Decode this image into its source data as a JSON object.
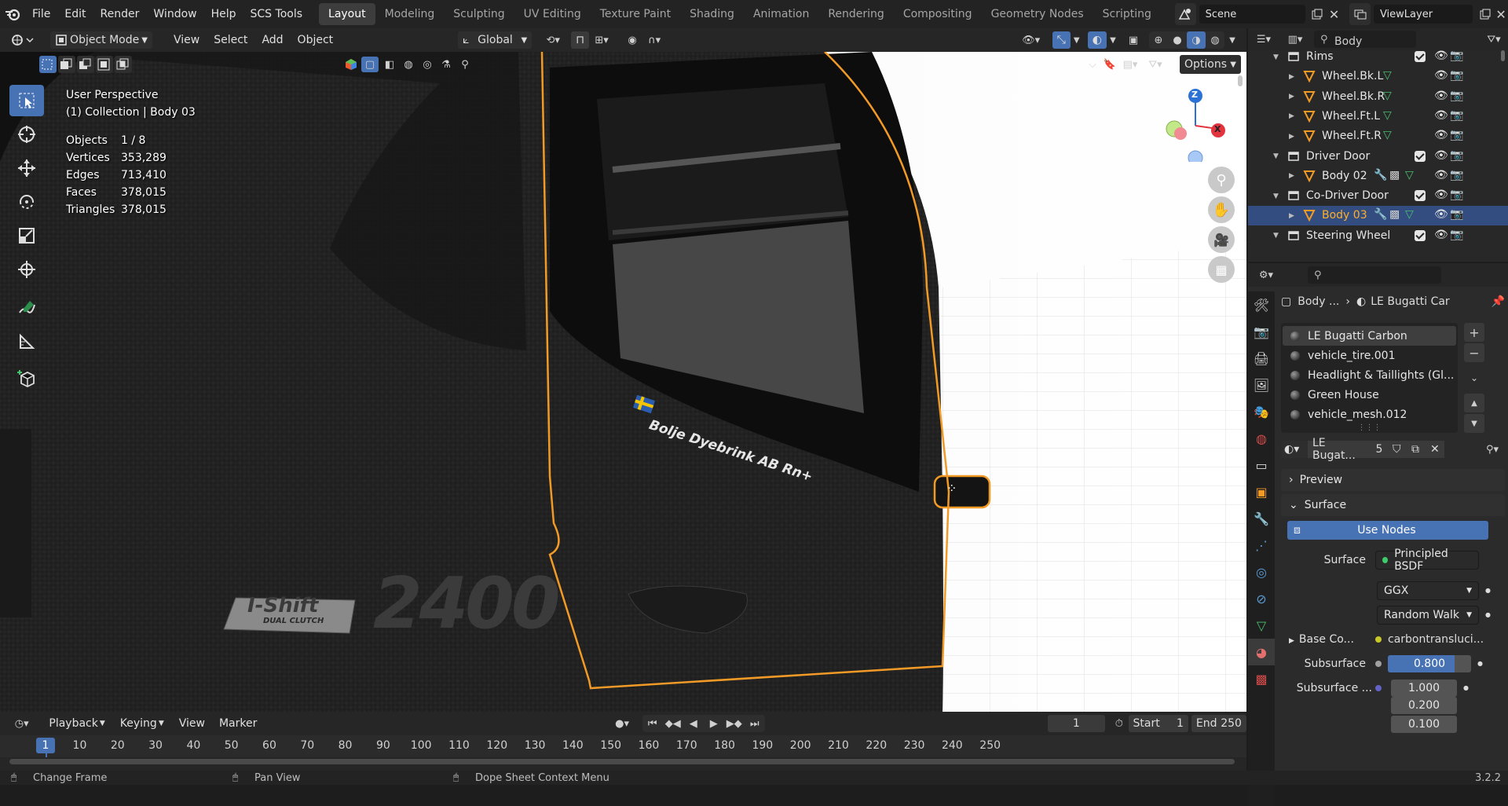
{
  "topbar": {
    "menus": [
      "File",
      "Edit",
      "Render",
      "Window",
      "Help",
      "SCS Tools"
    ],
    "workspaces": [
      "Layout",
      "Modeling",
      "Sculpting",
      "UV Editing",
      "Texture Paint",
      "Shading",
      "Animation",
      "Rendering",
      "Compositing",
      "Geometry Nodes",
      "Scripting"
    ],
    "active_workspace": "Layout",
    "scene": "Scene",
    "view_layer": "ViewLayer"
  },
  "viewport_header": {
    "mode": "Object Mode",
    "menus": [
      "View",
      "Select",
      "Add",
      "Object"
    ],
    "orientation": "Global",
    "options": "Options"
  },
  "overlay_text": {
    "perspective": "User Perspective",
    "collection": "(1) Collection | Body 03",
    "stats": [
      {
        "label": "Objects",
        "value": "1 / 8"
      },
      {
        "label": "Vertices",
        "value": "353,289"
      },
      {
        "label": "Edges",
        "value": "713,410"
      },
      {
        "label": "Faces",
        "value": "378,015"
      },
      {
        "label": "Triangles",
        "value": "378,015"
      }
    ]
  },
  "scene_decals": {
    "badge": "I-Shift",
    "badge_sub": "DUAL CLUTCH",
    "number": "2400",
    "sticker": "Bolje Dyebrink AB Rn+"
  },
  "outliner": {
    "top_partial": "Body",
    "rows": [
      {
        "label": "Rims",
        "type": "collection",
        "indent": 1
      },
      {
        "label": "Wheel.Bk.L",
        "type": "object",
        "indent": 2
      },
      {
        "label": "Wheel.Bk.R",
        "type": "object",
        "indent": 2
      },
      {
        "label": "Wheel.Ft.L",
        "type": "object",
        "indent": 2
      },
      {
        "label": "Wheel.Ft.R",
        "type": "object",
        "indent": 2
      },
      {
        "label": "Driver Door",
        "type": "collection",
        "indent": 1
      },
      {
        "label": "Body 02",
        "type": "object",
        "indent": 2
      },
      {
        "label": "Co-Driver Door",
        "type": "collection",
        "indent": 1
      },
      {
        "label": "Body 03",
        "type": "object",
        "indent": 2,
        "selected": true
      },
      {
        "label": "Steering Wheel",
        "type": "collection",
        "indent": 1
      }
    ],
    "bottom_partial": "Steering Wheel"
  },
  "properties": {
    "breadcrumb_object": "Body ...",
    "breadcrumb_material": "LE Bugatti Car",
    "material_slots": [
      "LE Bugatti Carbon",
      "vehicle_tire.001",
      "Headlight & Taillights (Gl...",
      "Green House",
      "vehicle_mesh.012"
    ],
    "material_name": "LE Bugat...",
    "users": "5",
    "panels": {
      "preview": "Preview",
      "surface": "Surface"
    },
    "use_nodes": "Use Nodes",
    "surface_label": "Surface",
    "surface_value": "Principled BSDF",
    "distribution": "GGX",
    "subsurface_method": "Random Walk",
    "base_color_label": "Base Co...",
    "base_color_value": "carbontransluci...",
    "subsurface_label": "Subsurface",
    "subsurface_value": "0.800",
    "subsurface_fill": 0.8,
    "subsurface_radius_label": "Subsurface ...",
    "subsurface_radius": [
      "1.000",
      "0.200",
      "0.100"
    ]
  },
  "timeline": {
    "menus": [
      "Playback",
      "Keying",
      "View",
      "Marker"
    ],
    "current_frame": "1",
    "start_label": "Start",
    "start": "1",
    "end_label": "End",
    "end": "250",
    "ruler": [
      "1",
      "10",
      "20",
      "30",
      "40",
      "50",
      "60",
      "70",
      "80",
      "90",
      "100",
      "110",
      "120",
      "130",
      "140",
      "150",
      "160",
      "170",
      "180",
      "190",
      "200",
      "210",
      "220",
      "230",
      "240",
      "250"
    ]
  },
  "statusbar": {
    "items": [
      "Change Frame",
      "Pan View",
      "Dope Sheet Context Menu"
    ],
    "version": "3.2.2"
  },
  "gizmo": {
    "z": "Z",
    "x": "X"
  },
  "colors": {
    "accent": "#4772b3",
    "selection_outline": "#f29a26",
    "active_text": "#ffaf29"
  }
}
